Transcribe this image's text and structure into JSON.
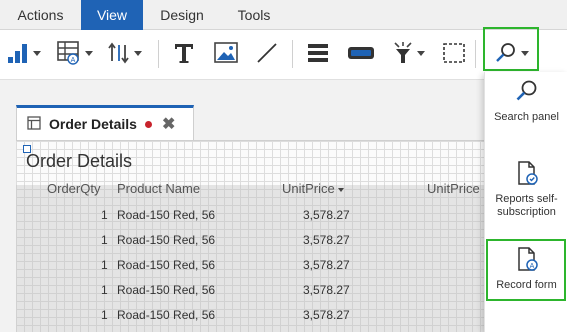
{
  "menubar": {
    "items": [
      {
        "label": "Actions",
        "active": false
      },
      {
        "label": "View",
        "active": true
      },
      {
        "label": "Design",
        "active": false
      },
      {
        "label": "Tools",
        "active": false
      }
    ]
  },
  "toolbar": {
    "buttons": [
      {
        "icon": "bar-chart-icon",
        "has_dropdown": true
      },
      {
        "icon": "table-grid-icon",
        "has_dropdown": true
      },
      {
        "icon": "sort-arrows-icon",
        "has_dropdown": true
      },
      {
        "icon": "text-icon",
        "has_dropdown": false
      },
      {
        "icon": "image-icon",
        "has_dropdown": false
      },
      {
        "icon": "line-icon",
        "has_dropdown": false
      },
      {
        "icon": "stack-icon",
        "has_dropdown": false
      },
      {
        "icon": "rectangle-icon",
        "has_dropdown": false
      },
      {
        "icon": "filter-icon",
        "has_dropdown": true
      },
      {
        "icon": "selection-icon",
        "has_dropdown": false
      },
      {
        "icon": "search-icon",
        "has_dropdown": true,
        "highlighted": true
      }
    ]
  },
  "tab": {
    "title": "Order Details",
    "unsaved": true
  },
  "report": {
    "title": "Order Details",
    "columns": [
      "OrderQty",
      "Product Name",
      "UnitPrice",
      "UnitPrice"
    ],
    "sorted_column_index": 2,
    "rows": [
      {
        "qty": "1",
        "product": "Road-150 Red, 56",
        "price": "3,578.27"
      },
      {
        "qty": "1",
        "product": "Road-150 Red, 56",
        "price": "3,578.27"
      },
      {
        "qty": "1",
        "product": "Road-150 Red, 56",
        "price": "3,578.27"
      },
      {
        "qty": "1",
        "product": "Road-150 Red, 56",
        "price": "3,578.27"
      },
      {
        "qty": "1",
        "product": "Road-150 Red, 56",
        "price": "3,578.27"
      }
    ]
  },
  "dropdown": {
    "items": [
      {
        "label": "Search panel",
        "icon": "search-icon",
        "highlighted": false
      },
      {
        "label": "Reports self-subscription",
        "icon": "report-subscription-icon",
        "highlighted": false
      },
      {
        "label": "Record form",
        "icon": "record-form-icon",
        "highlighted": true
      }
    ]
  },
  "colors": {
    "accent": "#1f63b5",
    "highlight": "#2db52d",
    "unsaved_dot": "#c8232c"
  }
}
